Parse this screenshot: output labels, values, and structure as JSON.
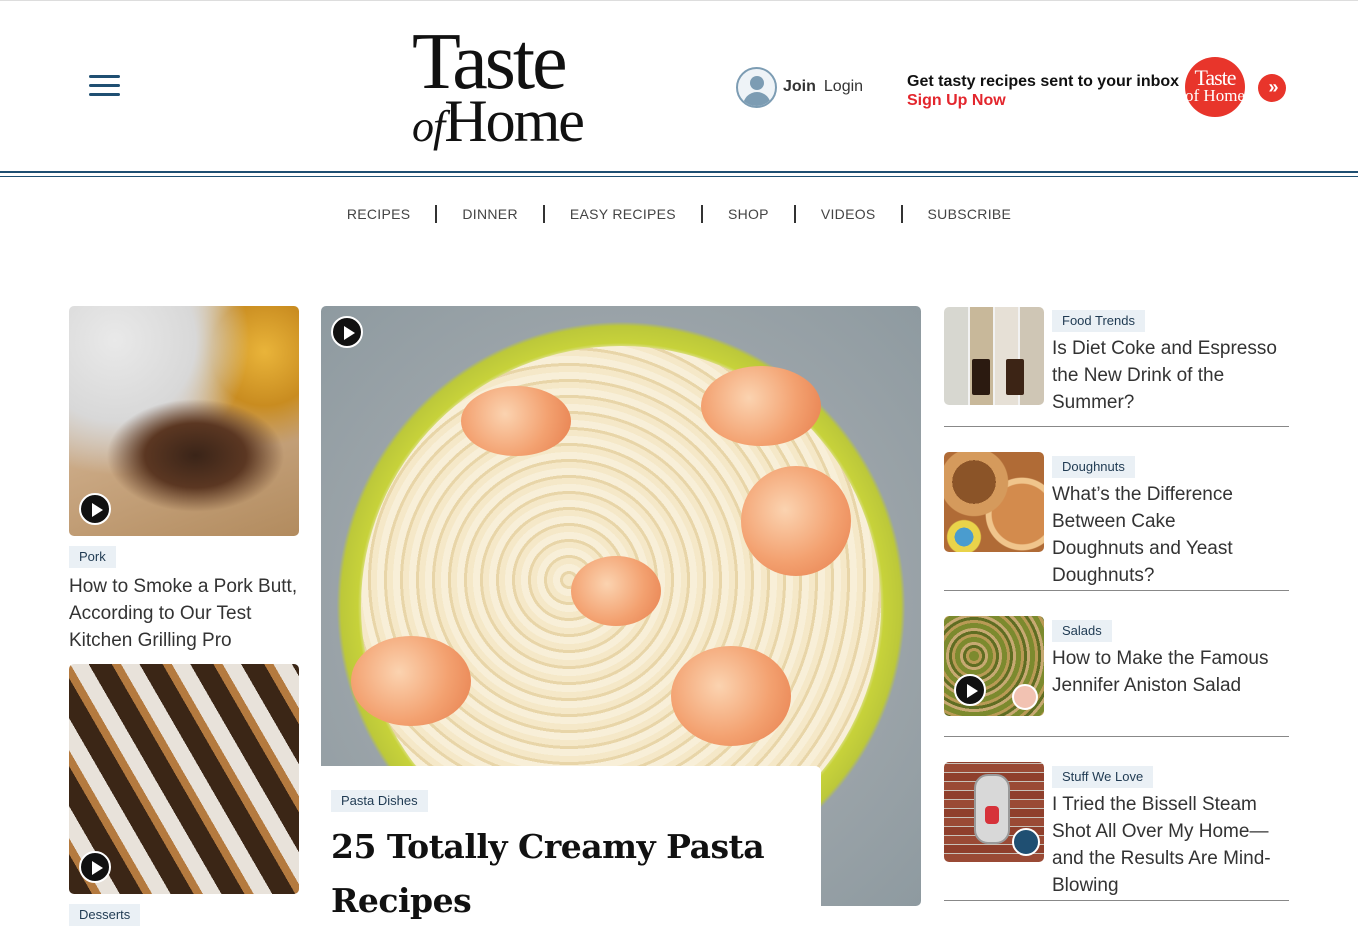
{
  "header": {
    "logo_line1": "Taste",
    "logo_of": "of",
    "logo_line2": "Home",
    "join_label": "Join",
    "login_label": "Login",
    "promo_text": "Get tasty recipes sent to your inbox",
    "promo_cta": "Sign Up Now",
    "promo_badge_line1": "Taste",
    "promo_badge_line2": "of Home",
    "promo_arrow": "»"
  },
  "nav": {
    "items": [
      "RECIPES",
      "DINNER",
      "EASY RECIPES",
      "SHOP",
      "VIDEOS",
      "SUBSCRIBE"
    ]
  },
  "left_column": {
    "cards": [
      {
        "tag": "Pork",
        "title": "How to Smoke a Pork Butt, According to Our Test Kitchen Grilling Pro",
        "has_video": true
      },
      {
        "tag": "Desserts",
        "title": "",
        "has_video": true
      }
    ]
  },
  "featured": {
    "tag": "Pasta Dishes",
    "title": "25 Totally Creamy Pasta Recipes",
    "has_video": true
  },
  "right_column": {
    "items": [
      {
        "tag": "Food Trends",
        "title": "Is Diet Coke and Espresso the New Drink of the Summer?",
        "has_video": false
      },
      {
        "tag": "Doughnuts",
        "title": "What’s the Difference Between Cake Doughnuts and Yeast Doughnuts?",
        "has_video": false
      },
      {
        "tag": "Salads",
        "title": "How to Make the Famous Jennifer Aniston Salad",
        "has_video": true
      },
      {
        "tag": "Stuff We Love",
        "title": "I Tried the Bissell Steam Shot All Over My Home—and the Results Are Mind-Blowing",
        "has_video": false
      }
    ]
  },
  "colors": {
    "brand_navy": "#1f4f72",
    "brand_red": "#e3262d",
    "tag_bg": "#eaf0f5"
  }
}
